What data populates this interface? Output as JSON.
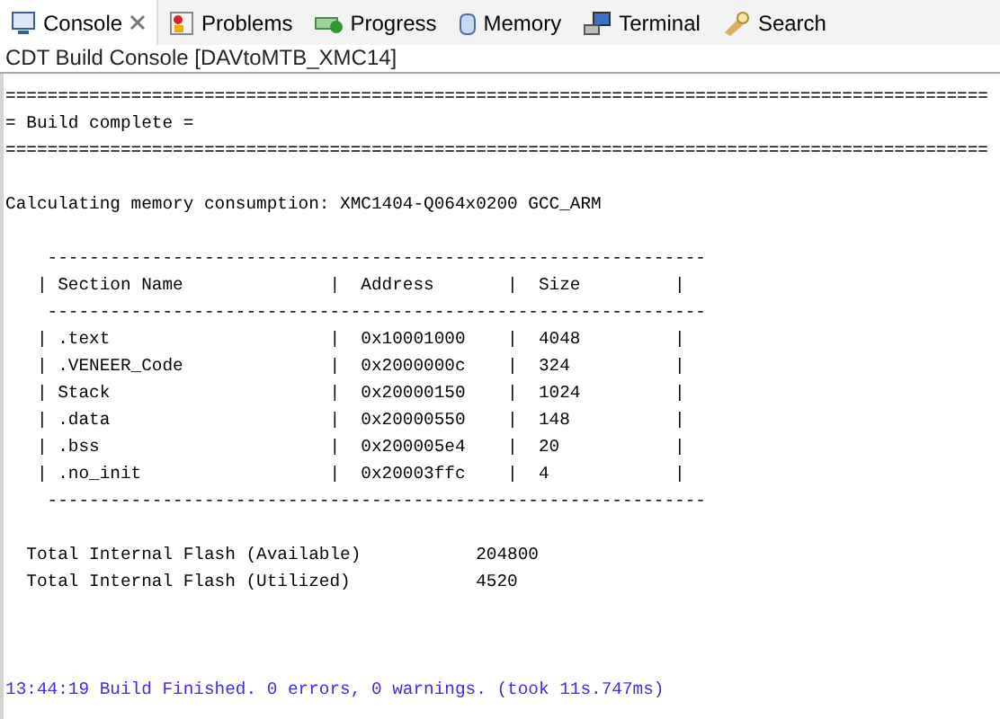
{
  "tabs": [
    {
      "label": "Console",
      "selected": true,
      "closable": true
    },
    {
      "label": "Problems",
      "selected": false,
      "closable": false
    },
    {
      "label": "Progress",
      "selected": false,
      "closable": false
    },
    {
      "label": "Memory",
      "selected": false,
      "closable": false
    },
    {
      "label": "Terminal",
      "selected": false,
      "closable": false
    },
    {
      "label": "Search",
      "selected": false,
      "closable": false
    }
  ],
  "console_title": "CDT Build Console [DAVtoMTB_XMC14]",
  "lines": [
    {
      "kind": "output",
      "text": "=============================================================================================="
    },
    {
      "kind": "output",
      "text": "= Build complete ="
    },
    {
      "kind": "output",
      "text": "=============================================================================================="
    },
    {
      "kind": "spacer"
    },
    {
      "kind": "output",
      "text": "Calculating memory consumption: XMC1404-Q064x0200 GCC_ARM"
    },
    {
      "kind": "spacer"
    },
    {
      "kind": "output",
      "text": "    ---------------------------------------------------------------"
    },
    {
      "kind": "output",
      "text": "   | Section Name              |  Address       |  Size         |"
    },
    {
      "kind": "output",
      "text": "    ---------------------------------------------------------------"
    },
    {
      "kind": "output",
      "text": "   | .text                     |  0x10001000    |  4048         |"
    },
    {
      "kind": "output",
      "text": "   | .VENEER_Code              |  0x2000000c    |  324          |"
    },
    {
      "kind": "output",
      "text": "   | Stack                     |  0x20000150    |  1024         |"
    },
    {
      "kind": "output",
      "text": "   | .data                     |  0x20000550    |  148          |"
    },
    {
      "kind": "output",
      "text": "   | .bss                      |  0x200005e4    |  20           |"
    },
    {
      "kind": "output",
      "text": "   | .no_init                  |  0x20003ffc    |  4            |"
    },
    {
      "kind": "output",
      "text": "    ---------------------------------------------------------------"
    },
    {
      "kind": "spacer"
    },
    {
      "kind": "output",
      "text": "  Total Internal Flash (Available)           204800"
    },
    {
      "kind": "output",
      "text": "  Total Internal Flash (Utilized)            4520"
    },
    {
      "kind": "spacer"
    },
    {
      "kind": "spacer"
    },
    {
      "kind": "spacer"
    },
    {
      "kind": "status",
      "text": "13:44:19 Build Finished. 0 errors, 0 warnings. (took 11s.747ms)"
    }
  ]
}
